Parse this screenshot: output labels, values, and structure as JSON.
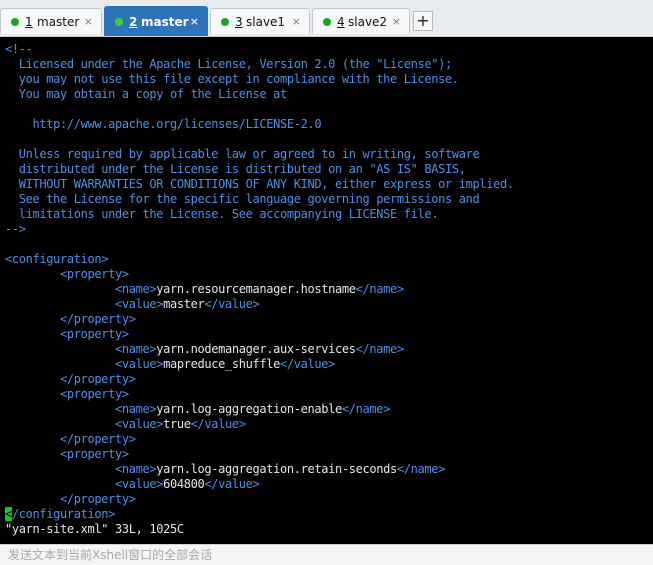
{
  "tabs": [
    {
      "number": "1",
      "label": "master",
      "close": "×"
    },
    {
      "number": "2",
      "label": "master",
      "close": "×"
    },
    {
      "number": "3",
      "label": "slave1",
      "close": "×"
    },
    {
      "number": "4",
      "label": "slave2",
      "close": "×"
    }
  ],
  "new_tab_label": "+",
  "terminal": {
    "comment": [
      "<!--",
      "  Licensed under the Apache License, Version 2.0 (the \"License\");",
      "  you may not use this file except in compliance with the License.",
      "  You may obtain a copy of the License at",
      "",
      "    http://www.apache.org/licenses/LICENSE-2.0",
      "",
      "  Unless required by applicable law or agreed to in writing, software",
      "  distributed under the License is distributed on an \"AS IS\" BASIS,",
      "  WITHOUT WARRANTIES OR CONDITIONS OF ANY KIND, either express or implied.",
      "  See the License for the specific language governing permissions and",
      "  limitations under the License. See accompanying LICENSE file.",
      "-->"
    ],
    "config_open": "<configuration>",
    "property_open": "<property>",
    "property_close": "</property>",
    "name_open": "<name>",
    "name_close": "</name>",
    "value_open": "<value>",
    "value_close": "</value>",
    "properties": [
      {
        "name": "yarn.resourcemanager.hostname",
        "value": "master"
      },
      {
        "name": "yarn.nodemanager.aux-services",
        "value": "mapreduce_shuffle"
      },
      {
        "name": "yarn.log-aggregation-enable",
        "value": "true"
      },
      {
        "name": "yarn.log-aggregation.retain-seconds",
        "value": "604800"
      }
    ],
    "config_close_cursor": "<",
    "config_close_rest": "/configuration>",
    "status_line": "\"yarn-site.xml\" 33L, 1025C"
  },
  "input_bar": {
    "placeholder": "发送文本到当前Xshell窗口的全部会话"
  },
  "colors": {
    "tab_active": "#2f73b9",
    "session_dot": "#1aa51a",
    "xml_blue": "#4f8fe6",
    "cursor": "#17c42b"
  }
}
